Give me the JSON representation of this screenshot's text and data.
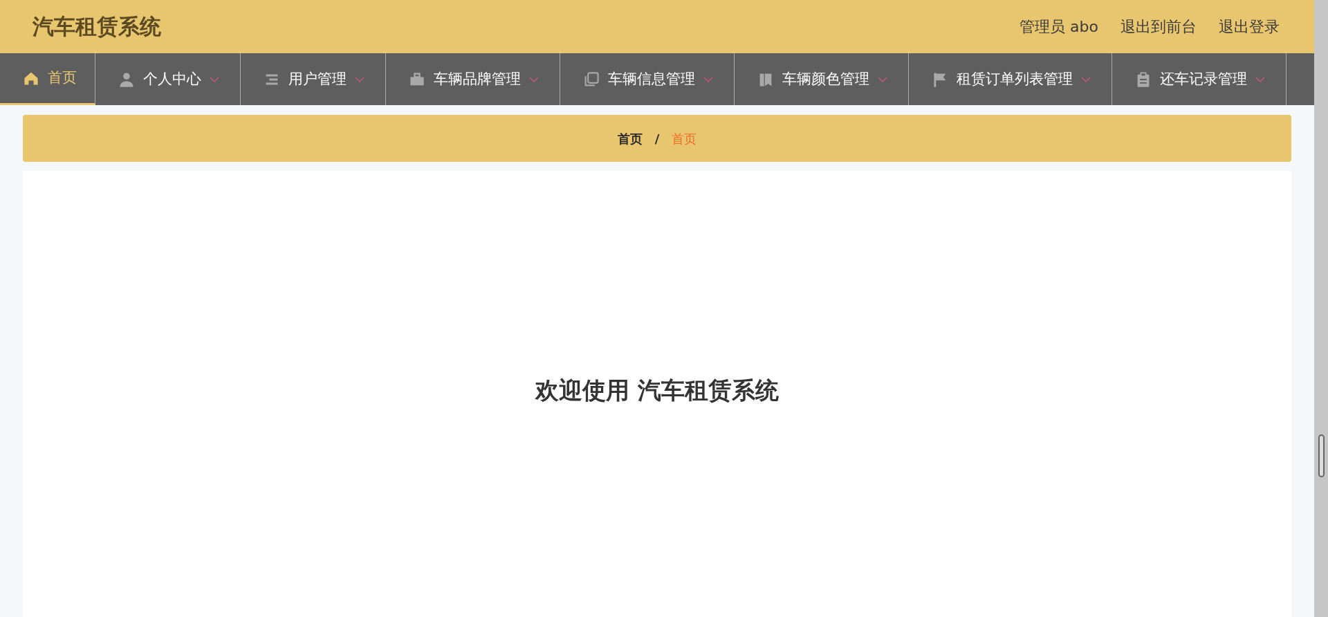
{
  "header": {
    "title": "汽车租赁系统",
    "links": [
      "管理员 abo",
      "退出到前台",
      "退出登录"
    ]
  },
  "nav": [
    {
      "label": "首页",
      "kind": "link",
      "selected": true
    },
    {
      "label": "个人中心",
      "kind": "dropdown",
      "selected": false
    },
    {
      "label": "用户管理",
      "kind": "dropdown",
      "selected": false
    },
    {
      "label": "车辆品牌管理",
      "kind": "dropdown",
      "selected": false
    },
    {
      "label": "车辆信息管理",
      "kind": "dropdown",
      "selected": false
    },
    {
      "label": "车辆颜色管理",
      "kind": "dropdown",
      "selected": false
    },
    {
      "label": "租赁订单列表管理",
      "kind": "dropdown",
      "selected": false
    },
    {
      "label": "还车记录管理",
      "kind": "dropdown",
      "selected": false
    }
  ],
  "breadcrumb": [
    {
      "label": "首页",
      "selected": false
    },
    {
      "label": "首页",
      "selected": true
    }
  ],
  "breadcrumb_separator": "/",
  "welcome": "欢迎使用 汽车租赁系统"
}
